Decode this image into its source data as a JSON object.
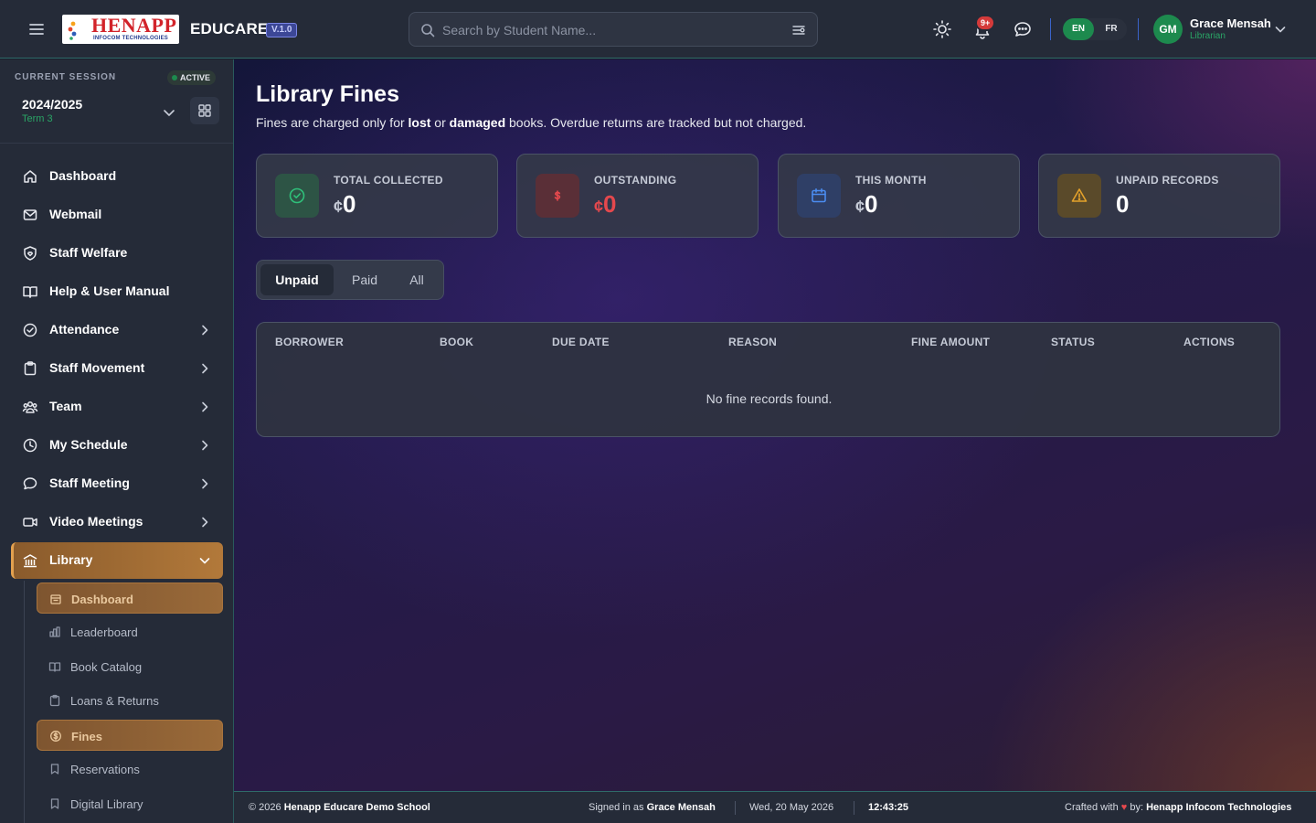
{
  "header": {
    "brand_word": "HENAPP",
    "brand_sub": "INFOCOM TECHNOLOGIES",
    "app_name": "EDUCARE",
    "version": "V.1.0",
    "search_placeholder": "Search by Student Name...",
    "notification_badge": "9+",
    "languages": [
      "EN",
      "FR"
    ],
    "active_language": "EN",
    "user": {
      "initials": "GM",
      "name": "Grace Mensah",
      "role": "Librarian"
    }
  },
  "session": {
    "label": "CURRENT SESSION",
    "status": "ACTIVE",
    "year": "2024/2025",
    "term": "Term 3"
  },
  "sidebar": {
    "items": [
      {
        "label": "Dashboard",
        "icon": "home-icon",
        "expandable": false
      },
      {
        "label": "Webmail",
        "icon": "mail-icon",
        "expandable": false
      },
      {
        "label": "Staff Welfare",
        "icon": "shield-heart-icon",
        "expandable": false
      },
      {
        "label": "Help & User Manual",
        "icon": "book-open-icon",
        "expandable": false
      },
      {
        "label": "Attendance",
        "icon": "check-circle-icon",
        "expandable": true
      },
      {
        "label": "Staff Movement",
        "icon": "clipboard-icon",
        "expandable": true
      },
      {
        "label": "Team",
        "icon": "users-icon",
        "expandable": true
      },
      {
        "label": "My Schedule",
        "icon": "clock-icon",
        "expandable": true
      },
      {
        "label": "Staff Meeting",
        "icon": "chat-icon",
        "expandable": true
      },
      {
        "label": "Video Meetings",
        "icon": "video-icon",
        "expandable": true
      },
      {
        "label": "Library",
        "icon": "library-icon",
        "expandable": true,
        "expanded": true,
        "active": true
      }
    ],
    "library_sub": [
      {
        "label": "Dashboard",
        "icon": "dashboard-icon",
        "highlighted": true
      },
      {
        "label": "Leaderboard",
        "icon": "bar-chart-icon"
      },
      {
        "label": "Book Catalog",
        "icon": "book-open-icon"
      },
      {
        "label": "Loans & Returns",
        "icon": "clipboard-icon"
      },
      {
        "label": "Fines",
        "icon": "coin-icon",
        "active": true
      },
      {
        "label": "Reservations",
        "icon": "bookmark-icon"
      },
      {
        "label": "Digital Library",
        "icon": "bookmark-icon"
      }
    ]
  },
  "page": {
    "title": "Library Fines",
    "subtitle_parts": [
      "Fines are charged only for ",
      "lost",
      " or ",
      "damaged",
      " books. Overdue returns are tracked but not charged."
    ]
  },
  "stats": [
    {
      "label": "TOTAL COLLECTED",
      "currency": "¢",
      "value": "0",
      "icon": "check-circle-icon",
      "color": "#2aa566"
    },
    {
      "label": "OUTSTANDING",
      "currency": "¢",
      "value": "0",
      "icon": "dollar-icon",
      "color": "#e5484d"
    },
    {
      "label": "THIS MONTH",
      "currency": "¢",
      "value": "0",
      "icon": "calendar-icon",
      "color": "#4b8cf0"
    },
    {
      "label": "UNPAID RECORDS",
      "currency": "",
      "value": "0",
      "icon": "warning-icon",
      "color": "#e3a12a"
    }
  ],
  "tabs": [
    "Unpaid",
    "Paid",
    "All"
  ],
  "active_tab": "Unpaid",
  "table": {
    "columns": [
      "BORROWER",
      "BOOK",
      "DUE DATE",
      "REASON",
      "FINE AMOUNT",
      "STATUS",
      "ACTIONS"
    ],
    "rows": [],
    "empty_message": "No fine records found."
  },
  "footer": {
    "copyright_prefix": "© 2026",
    "school": "Henapp Educare Demo School",
    "signed_prefix": "Signed in as",
    "signed_user": "Grace Mensah",
    "date": "Wed, 20 May 2026",
    "time": "12:43:25",
    "crafted_prefix": "Crafted with",
    "heart": "♥",
    "crafted_by": "by:",
    "company": "Henapp Infocom Technologies"
  }
}
